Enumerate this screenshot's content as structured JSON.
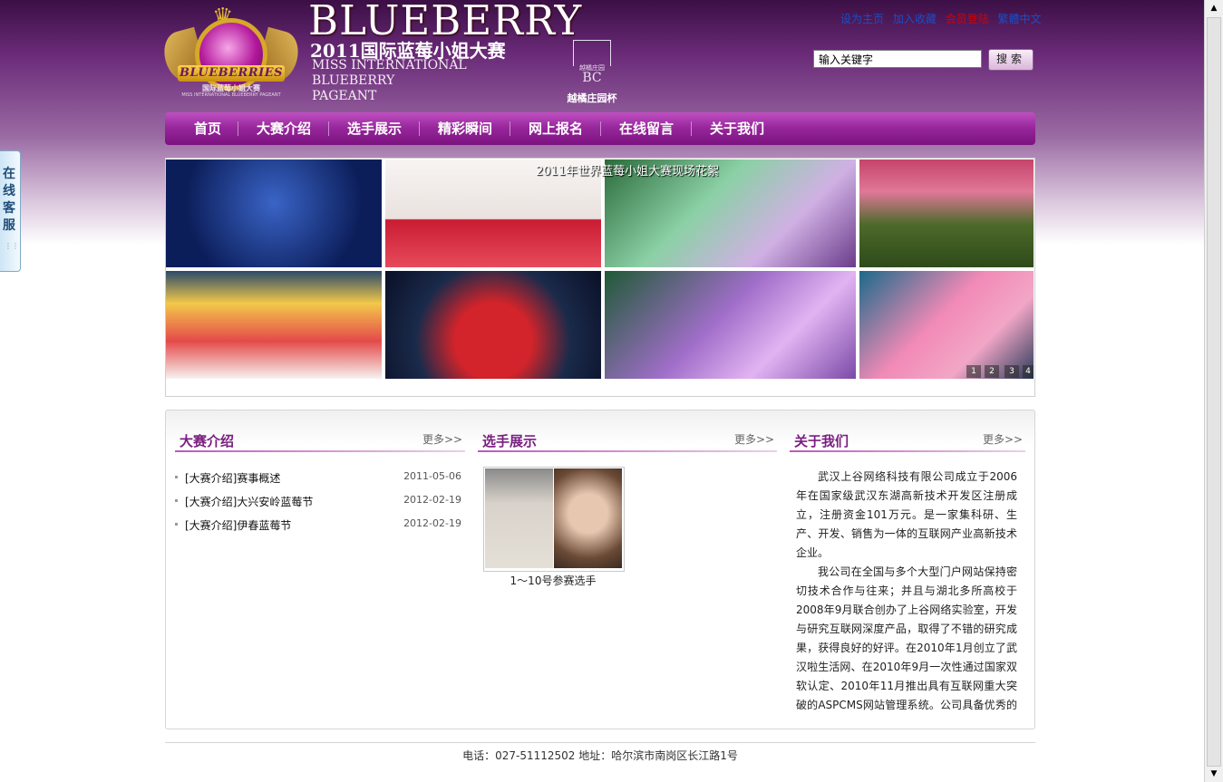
{
  "header": {
    "logo_ribbon": "BLUEBERRIES",
    "logo_sub1": "国际蓝莓小姐大赛",
    "logo_sub2": "MISS INTERNATIONAL BLUEBERRY PAGEANT",
    "brand_big": "BLUEBERRY",
    "brand_cn": "2011国际蓝莓小姐大赛",
    "brand_en": [
      "MISS INTERNATIONAL",
      "BLUEBERRY",
      "PAGEANT"
    ],
    "chateau_cn": "越橘庄园",
    "chateau_bc": "BC",
    "chateau_cup": "越橘庄园杯",
    "top_links": [
      {
        "label": "设为主页",
        "color": "#1a4fc4"
      },
      {
        "label": "加入收藏",
        "color": "#1a4fc4"
      },
      {
        "label": "会员登陆",
        "color": "#d40000"
      },
      {
        "label": "繁體中文",
        "color": "#1a4fc4"
      }
    ],
    "search_value": "输入关键字",
    "search_button": "搜索"
  },
  "nav": [
    "首页",
    "大赛介绍",
    "选手展示",
    "精彩瞬间",
    "网上报名",
    "在线留言",
    "关于我们"
  ],
  "side_tab": "在线客服",
  "banner": {
    "caption": "2011年世界蓝莓小姐大赛现场花絮",
    "pages": [
      "1",
      "2",
      "3",
      "4"
    ]
  },
  "sections": {
    "intro": {
      "title": "大赛介绍",
      "more": "更多>>",
      "items": [
        {
          "title": "[大赛介绍]赛事概述",
          "date": "2011-05-06"
        },
        {
          "title": "[大赛介绍]大兴安岭蓝莓节",
          "date": "2012-02-19"
        },
        {
          "title": "[大赛介绍]伊春蓝莓节",
          "date": "2012-02-19"
        }
      ]
    },
    "players": {
      "title": "选手展示",
      "more": "更多>>",
      "caption": "1～10号参赛选手"
    },
    "about": {
      "title": "关于我们",
      "more": "更多>>",
      "paragraphs": [
        "武汉上谷网络科技有限公司成立于2006年在国家级武汉东湖高新技术开发区注册成立，注册资金101万元。是一家集科研、生产、开发、销售为一体的互联网产业高新技术企业。",
        "我公司在全国与多个大型门户网站保持密切技术合作与往来；并且与湖北多所高校于2008年9月联合创办了上谷网络实验室，开发与研究互联网深度产品，取得了不错的研究成果，获得良好的好评。在2010年1月创立了武汉啦生活网、在2010年9月一次性通过国家双软认定、2010年11月推出具有互联网重大突破的ASPCMS网站管理系统。公司具备优秀的技术梯队，多年来一直致力于以互联网为依托，开"
      ]
    }
  },
  "footer": "电话：027-51112502  地址：哈尔滨市南岗区长江路1号",
  "colors": {
    "nav_purple": "#98289d",
    "title_purple": "#7a1f80",
    "link_blue": "#1a4fc4",
    "link_red": "#d40000"
  }
}
